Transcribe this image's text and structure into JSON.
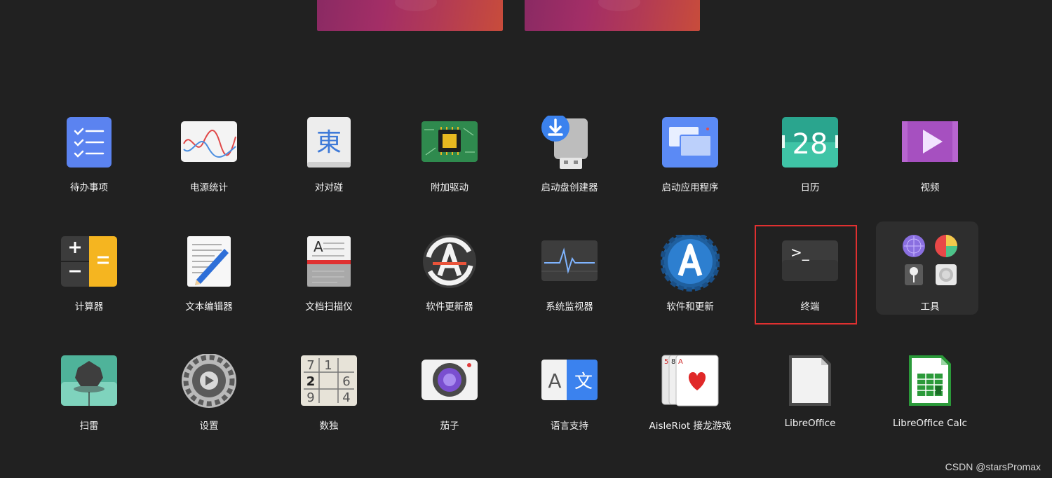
{
  "workspaces": [
    "workspace-1",
    "workspace-2"
  ],
  "apps": {
    "todo": {
      "label": "待办事项",
      "icon": "todo-checklist-icon"
    },
    "power_stats": {
      "label": "电源统计",
      "icon": "power-statistics-icon"
    },
    "mahjongg": {
      "label": "对对碰",
      "icon": "mahjongg-tile-icon",
      "glyph": "東"
    },
    "drivers": {
      "label": "附加驱动",
      "icon": "chip-icon"
    },
    "usb_creator": {
      "label": "启动盘创建器",
      "icon": "usb-download-icon"
    },
    "app_launcher": {
      "label": "启动应用程序",
      "icon": "startup-window-icon"
    },
    "calendar": {
      "label": "日历",
      "icon": "calendar-icon",
      "day": "28"
    },
    "videos": {
      "label": "视频",
      "icon": "video-play-icon"
    },
    "calculator": {
      "label": "计算器",
      "icon": "calculator-icon"
    },
    "text_editor": {
      "label": "文本编辑器",
      "icon": "text-editor-pencil-icon"
    },
    "scanner": {
      "label": "文档扫描仪",
      "icon": "document-scanner-icon",
      "glyph": "A"
    },
    "updater": {
      "label": "软件更新器",
      "icon": "software-updater-icon"
    },
    "monitor": {
      "label": "系统监视器",
      "icon": "system-monitor-icon"
    },
    "software_updates": {
      "label": "软件和更新",
      "icon": "software-gear-icon"
    },
    "terminal": {
      "label": "终端",
      "icon": "terminal-icon",
      "prompt": ">_"
    },
    "tools": {
      "label": "工具",
      "icon": "tools-folder-icon"
    },
    "mines": {
      "label": "扫雷",
      "icon": "mine-icon"
    },
    "settings": {
      "label": "设置",
      "icon": "settings-gear-icon"
    },
    "sudoku": {
      "label": "数独",
      "icon": "sudoku-grid-icon",
      "digits": [
        "7",
        "1",
        "",
        "2",
        "",
        "6",
        "9",
        "",
        "4"
      ]
    },
    "cheese": {
      "label": "茄子",
      "icon": "camera-icon"
    },
    "language": {
      "label": "语言支持",
      "icon": "language-icon",
      "latin": "A",
      "cjk": "文"
    },
    "aisleriot": {
      "label": "AisleRiot 接龙游戏",
      "icon": "playing-cards-icon",
      "cards": [
        "5",
        "8",
        "A"
      ]
    },
    "libreoffice": {
      "label": "LibreOffice",
      "icon": "libreoffice-document-icon"
    },
    "calc": {
      "label": "LibreOffice Calc",
      "icon": "libreoffice-calc-icon"
    }
  },
  "watermark": "CSDN @starsPromax",
  "colors": {
    "background": "#212121",
    "highlight": "#e03030",
    "accent_blue": "#5b8af5"
  }
}
